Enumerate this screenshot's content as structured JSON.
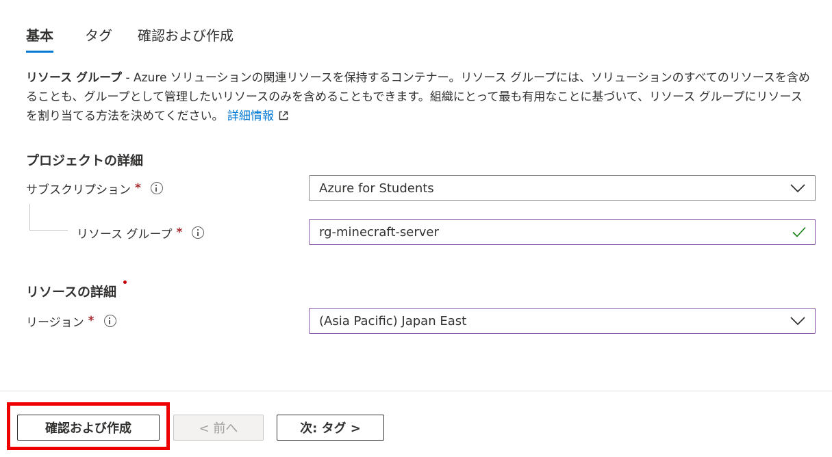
{
  "tabs": [
    {
      "label": "基本",
      "active": true
    },
    {
      "label": "タグ",
      "active": false
    },
    {
      "label": "確認および作成",
      "active": false
    }
  ],
  "description": {
    "lead": "リソース グループ",
    "text": " - Azure ソリューションの関連リソースを保持するコンテナー。リソース グループには、ソリューションのすべてのリソースを含めることも、グループとして管理したいリソースのみを含めることもできます。組織にとって最も有用なことに基づいて、リソース グループにリソースを割り当てる方法を決めてください。",
    "link": "詳細情報",
    "link_icon": "external-link-icon"
  },
  "project": {
    "title": "プロジェクトの詳細",
    "subscription_label": "サブスクリプション",
    "subscription_value": "Azure for Students",
    "resource_group_label": "リソース グループ",
    "resource_group_value": "rg-minecraft-server"
  },
  "resource": {
    "title": "リソースの詳細",
    "region_label": "リージョン",
    "region_value": "(Asia Pacific) Japan East"
  },
  "required_mark": "*",
  "colors": {
    "accent": "#0078d4",
    "required": "#a4262c",
    "valid": "#107c10",
    "highlight": "#ee0000"
  },
  "footer": {
    "review_create": "確認および作成",
    "prev": "< 前へ",
    "next": "次: タグ >"
  }
}
